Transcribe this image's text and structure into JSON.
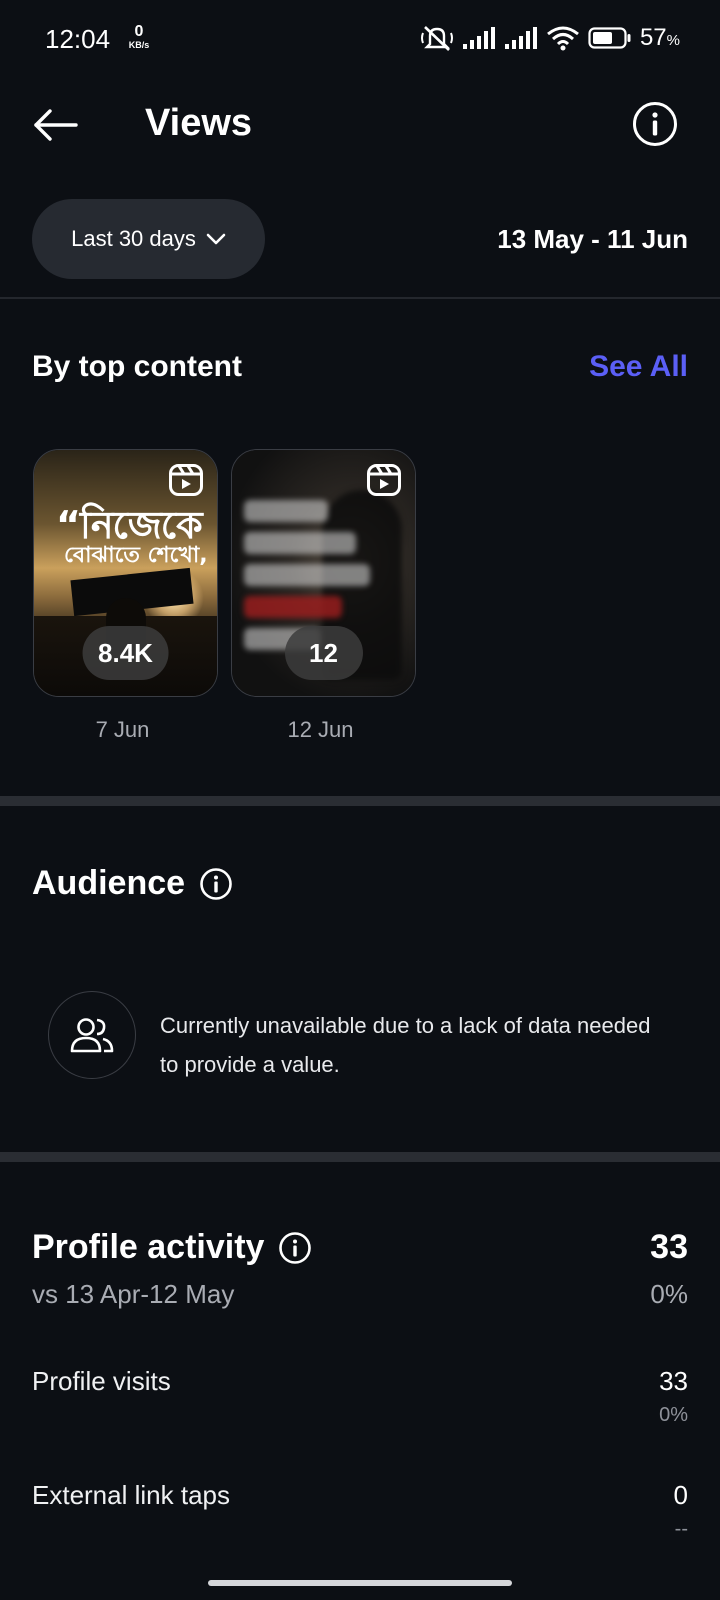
{
  "status_bar": {
    "time": "12:04",
    "net_speed": "0",
    "net_unit": "KB/s",
    "battery_pct": "57",
    "battery_unit": "%",
    "icons": [
      "mute-icon",
      "signal-icon",
      "signal-icon",
      "wifi-icon",
      "battery-icon"
    ]
  },
  "header": {
    "title": "Views"
  },
  "range": {
    "selected": "Last 30 days",
    "dates": "13 May - 11 Jun"
  },
  "top_content": {
    "title": "By top content",
    "see_all": "See All",
    "items": [
      {
        "views": "8.4K",
        "date": "7 Jun",
        "caption_line1": "“নিজেকে",
        "caption_line2": "বোঝাতে শেখো,"
      },
      {
        "views": "12",
        "date": "12 Jun"
      }
    ]
  },
  "audience": {
    "title": "Audience",
    "message": "Currently unavailable due to a lack of data needed to provide a value."
  },
  "profile_activity": {
    "title": "Profile activity",
    "comparison": "vs 13 Apr-12 May",
    "total": "33",
    "change": "0%",
    "rows": [
      {
        "label": "Profile visits",
        "value": "33",
        "change": "0%"
      },
      {
        "label": "External link taps",
        "value": "0",
        "change": "--"
      }
    ]
  },
  "colors": {
    "background": "#0c0f14",
    "accent": "#5b5ff6",
    "pill": "#262a31",
    "muted": "#a9acb3"
  }
}
